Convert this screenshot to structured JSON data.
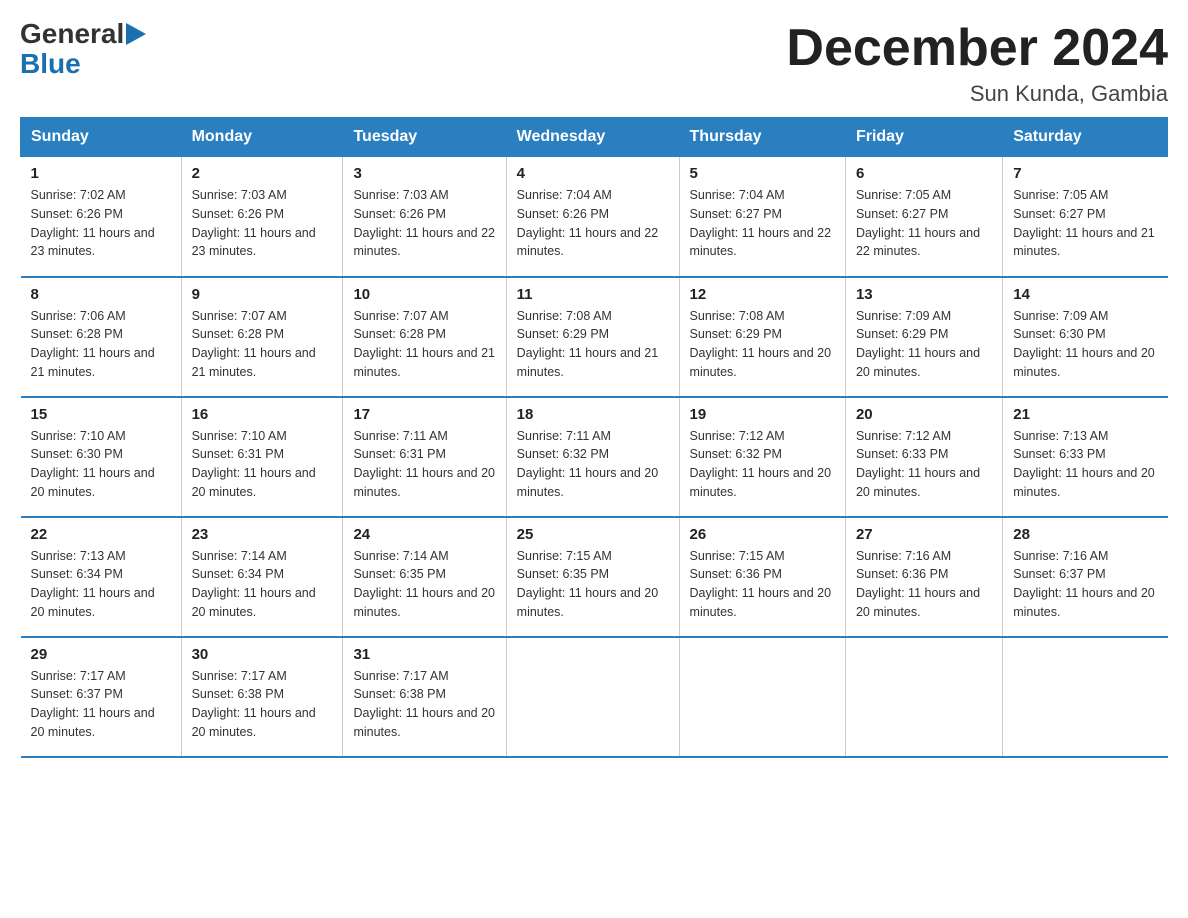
{
  "logo": {
    "part1": "General",
    "arrow": "▶",
    "part2": "Blue"
  },
  "title": "December 2024",
  "location": "Sun Kunda, Gambia",
  "headers": [
    "Sunday",
    "Monday",
    "Tuesday",
    "Wednesday",
    "Thursday",
    "Friday",
    "Saturday"
  ],
  "weeks": [
    [
      {
        "day": "1",
        "sunrise": "7:02 AM",
        "sunset": "6:26 PM",
        "daylight": "11 hours and 23 minutes."
      },
      {
        "day": "2",
        "sunrise": "7:03 AM",
        "sunset": "6:26 PM",
        "daylight": "11 hours and 23 minutes."
      },
      {
        "day": "3",
        "sunrise": "7:03 AM",
        "sunset": "6:26 PM",
        "daylight": "11 hours and 22 minutes."
      },
      {
        "day": "4",
        "sunrise": "7:04 AM",
        "sunset": "6:26 PM",
        "daylight": "11 hours and 22 minutes."
      },
      {
        "day": "5",
        "sunrise": "7:04 AM",
        "sunset": "6:27 PM",
        "daylight": "11 hours and 22 minutes."
      },
      {
        "day": "6",
        "sunrise": "7:05 AM",
        "sunset": "6:27 PM",
        "daylight": "11 hours and 22 minutes."
      },
      {
        "day": "7",
        "sunrise": "7:05 AM",
        "sunset": "6:27 PM",
        "daylight": "11 hours and 21 minutes."
      }
    ],
    [
      {
        "day": "8",
        "sunrise": "7:06 AM",
        "sunset": "6:28 PM",
        "daylight": "11 hours and 21 minutes."
      },
      {
        "day": "9",
        "sunrise": "7:07 AM",
        "sunset": "6:28 PM",
        "daylight": "11 hours and 21 minutes."
      },
      {
        "day": "10",
        "sunrise": "7:07 AM",
        "sunset": "6:28 PM",
        "daylight": "11 hours and 21 minutes."
      },
      {
        "day": "11",
        "sunrise": "7:08 AM",
        "sunset": "6:29 PM",
        "daylight": "11 hours and 21 minutes."
      },
      {
        "day": "12",
        "sunrise": "7:08 AM",
        "sunset": "6:29 PM",
        "daylight": "11 hours and 20 minutes."
      },
      {
        "day": "13",
        "sunrise": "7:09 AM",
        "sunset": "6:29 PM",
        "daylight": "11 hours and 20 minutes."
      },
      {
        "day": "14",
        "sunrise": "7:09 AM",
        "sunset": "6:30 PM",
        "daylight": "11 hours and 20 minutes."
      }
    ],
    [
      {
        "day": "15",
        "sunrise": "7:10 AM",
        "sunset": "6:30 PM",
        "daylight": "11 hours and 20 minutes."
      },
      {
        "day": "16",
        "sunrise": "7:10 AM",
        "sunset": "6:31 PM",
        "daylight": "11 hours and 20 minutes."
      },
      {
        "day": "17",
        "sunrise": "7:11 AM",
        "sunset": "6:31 PM",
        "daylight": "11 hours and 20 minutes."
      },
      {
        "day": "18",
        "sunrise": "7:11 AM",
        "sunset": "6:32 PM",
        "daylight": "11 hours and 20 minutes."
      },
      {
        "day": "19",
        "sunrise": "7:12 AM",
        "sunset": "6:32 PM",
        "daylight": "11 hours and 20 minutes."
      },
      {
        "day": "20",
        "sunrise": "7:12 AM",
        "sunset": "6:33 PM",
        "daylight": "11 hours and 20 minutes."
      },
      {
        "day": "21",
        "sunrise": "7:13 AM",
        "sunset": "6:33 PM",
        "daylight": "11 hours and 20 minutes."
      }
    ],
    [
      {
        "day": "22",
        "sunrise": "7:13 AM",
        "sunset": "6:34 PM",
        "daylight": "11 hours and 20 minutes."
      },
      {
        "day": "23",
        "sunrise": "7:14 AM",
        "sunset": "6:34 PM",
        "daylight": "11 hours and 20 minutes."
      },
      {
        "day": "24",
        "sunrise": "7:14 AM",
        "sunset": "6:35 PM",
        "daylight": "11 hours and 20 minutes."
      },
      {
        "day": "25",
        "sunrise": "7:15 AM",
        "sunset": "6:35 PM",
        "daylight": "11 hours and 20 minutes."
      },
      {
        "day": "26",
        "sunrise": "7:15 AM",
        "sunset": "6:36 PM",
        "daylight": "11 hours and 20 minutes."
      },
      {
        "day": "27",
        "sunrise": "7:16 AM",
        "sunset": "6:36 PM",
        "daylight": "11 hours and 20 minutes."
      },
      {
        "day": "28",
        "sunrise": "7:16 AM",
        "sunset": "6:37 PM",
        "daylight": "11 hours and 20 minutes."
      }
    ],
    [
      {
        "day": "29",
        "sunrise": "7:17 AM",
        "sunset": "6:37 PM",
        "daylight": "11 hours and 20 minutes."
      },
      {
        "day": "30",
        "sunrise": "7:17 AM",
        "sunset": "6:38 PM",
        "daylight": "11 hours and 20 minutes."
      },
      {
        "day": "31",
        "sunrise": "7:17 AM",
        "sunset": "6:38 PM",
        "daylight": "11 hours and 20 minutes."
      },
      null,
      null,
      null,
      null
    ]
  ]
}
